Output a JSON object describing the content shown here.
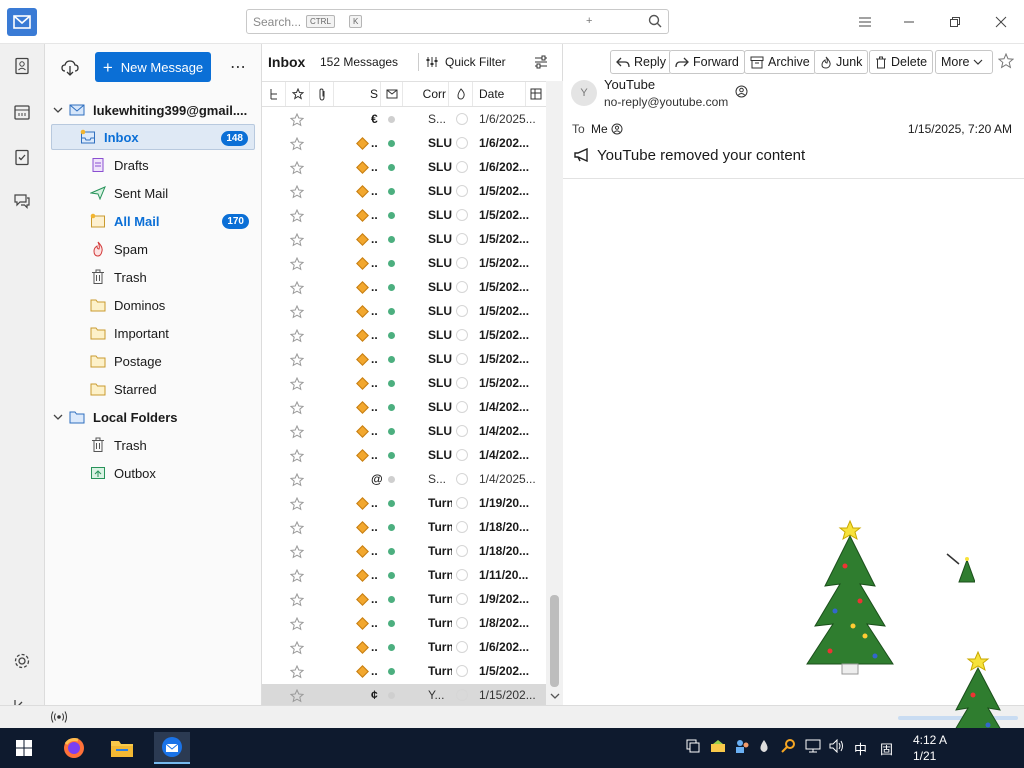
{
  "search": {
    "placeholder": "Search...",
    "kbd1": "CTRL",
    "plus": "+",
    "kbd2": "K"
  },
  "folderpane": {
    "new_message": "New Message",
    "more": "⋯",
    "account": "lukewhiting399@gmail....",
    "folders": [
      {
        "label": "Inbox",
        "badge": "148"
      },
      {
        "label": "Drafts"
      },
      {
        "label": "Sent Mail"
      },
      {
        "label": "All Mail",
        "badge": "170"
      },
      {
        "label": "Spam"
      },
      {
        "label": "Trash"
      },
      {
        "label": "Dominos"
      },
      {
        "label": "Important"
      },
      {
        "label": "Postage"
      },
      {
        "label": "Starred"
      }
    ],
    "local": "Local Folders",
    "local_folders": [
      {
        "label": "Trash"
      },
      {
        "label": "Outbox"
      }
    ]
  },
  "threadpane": {
    "title": "Inbox",
    "count": "152 Messages",
    "quick_filter": "Quick Filter",
    "columns": {
      "s": "S",
      "corr": "Corr",
      "date": "Date"
    },
    "rows": [
      {
        "dots": "€",
        "corr": "S...",
        "date": "1/6/2025...",
        "read": true,
        "tag": false
      },
      {
        "dots": "..",
        "corr": "SLU",
        "date": "1/6/202...",
        "read": false,
        "tag": true
      },
      {
        "dots": "..",
        "corr": "SLU",
        "date": "1/6/202...",
        "read": false,
        "tag": true
      },
      {
        "dots": "..",
        "corr": "SLU",
        "date": "1/5/202...",
        "read": false,
        "tag": true
      },
      {
        "dots": "..",
        "corr": "SLU",
        "date": "1/5/202...",
        "read": false,
        "tag": true
      },
      {
        "dots": "..",
        "corr": "SLU",
        "date": "1/5/202...",
        "read": false,
        "tag": true
      },
      {
        "dots": "..",
        "corr": "SLU",
        "date": "1/5/202...",
        "read": false,
        "tag": true
      },
      {
        "dots": "..",
        "corr": "SLU",
        "date": "1/5/202...",
        "read": false,
        "tag": true
      },
      {
        "dots": "..",
        "corr": "SLU",
        "date": "1/5/202...",
        "read": false,
        "tag": true
      },
      {
        "dots": "..",
        "corr": "SLU",
        "date": "1/5/202...",
        "read": false,
        "tag": true
      },
      {
        "dots": "..",
        "corr": "SLU",
        "date": "1/5/202...",
        "read": false,
        "tag": true
      },
      {
        "dots": "..",
        "corr": "SLU",
        "date": "1/5/202...",
        "read": false,
        "tag": true
      },
      {
        "dots": "..",
        "corr": "SLU",
        "date": "1/4/202...",
        "read": false,
        "tag": true
      },
      {
        "dots": "..",
        "corr": "SLU",
        "date": "1/4/202...",
        "read": false,
        "tag": true
      },
      {
        "dots": "..",
        "corr": "SLU",
        "date": "1/4/202...",
        "read": false,
        "tag": true
      },
      {
        "dots": "@",
        "corr": "S...",
        "date": "1/4/2025...",
        "read": true,
        "tag": false
      },
      {
        "dots": "..",
        "corr": "Turn",
        "date": "1/19/20...",
        "read": false,
        "tag": true
      },
      {
        "dots": "..",
        "corr": "Turn",
        "date": "1/18/20...",
        "read": false,
        "tag": true
      },
      {
        "dots": "..",
        "corr": "Turn",
        "date": "1/18/20...",
        "read": false,
        "tag": true
      },
      {
        "dots": "..",
        "corr": "Turn",
        "date": "1/11/20...",
        "read": false,
        "tag": true
      },
      {
        "dots": "..",
        "corr": "Turn",
        "date": "1/9/202...",
        "read": false,
        "tag": true
      },
      {
        "dots": "..",
        "corr": "Turn",
        "date": "1/8/202...",
        "read": false,
        "tag": true
      },
      {
        "dots": "..",
        "corr": "Turn",
        "date": "1/6/202...",
        "read": false,
        "tag": true
      },
      {
        "dots": "..",
        "corr": "Turn",
        "date": "1/5/202...",
        "read": false,
        "tag": true
      },
      {
        "dots": "¢",
        "corr": "Y...",
        "date": "1/15/202...",
        "read": true,
        "tag": false,
        "selected": true
      }
    ]
  },
  "message": {
    "buttons": {
      "reply": "Reply",
      "forward": "Forward",
      "archive": "Archive",
      "junk": "Junk",
      "delete": "Delete",
      "more": "More"
    },
    "avatar": "Y",
    "from_name": "YouTube",
    "from_addr": "no-reply@youtube.com",
    "to_label": "To",
    "to_name": "Me",
    "date": "1/15/2025, 7:20 AM",
    "subject": "YouTube removed your content"
  },
  "taskbar": {
    "ime1": "中",
    "ime2": "固",
    "time": "4:12 A",
    "date": "1/21"
  },
  "colors": {
    "accent": "#0b6fd6",
    "badge": "#0b6fd6",
    "tag": "#f2a72e",
    "unread_dot": "#4caf7f"
  }
}
